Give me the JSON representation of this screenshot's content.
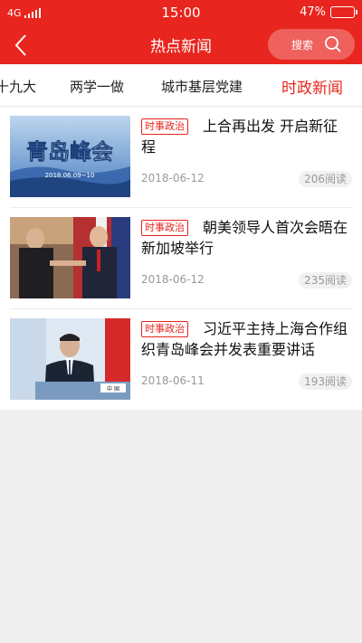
{
  "status_bar": {
    "network": "4G",
    "time": "15:00",
    "battery": "47%"
  },
  "header": {
    "title": "热点新闻",
    "search_label": "搜索"
  },
  "tabs": [
    {
      "label": "十九大"
    },
    {
      "label": "两学一做"
    },
    {
      "label": "城市基层党建"
    },
    {
      "label": "时政新闻",
      "active": true
    }
  ],
  "news": [
    {
      "tag": "时事政治",
      "title": "上合再出发 开启新征程",
      "date": "2018-06-12",
      "reads": "206阅读",
      "thumb_text": "青岛峰会",
      "thumb_date": "2018.06.09~10"
    },
    {
      "tag": "时事政治",
      "title": "朝美领导人首次会晤在新加坡举行",
      "date": "2018-06-12",
      "reads": "235阅读"
    },
    {
      "tag": "时事政治",
      "title": "习近平主持上海合作组织青岛峰会并发表重要讲话",
      "date": "2018-06-11",
      "reads": "193阅读",
      "thumb_text": "中 国"
    }
  ],
  "colors": {
    "brand": "#e8251e",
    "muted": "#999999",
    "page_bg": "#efefef"
  }
}
